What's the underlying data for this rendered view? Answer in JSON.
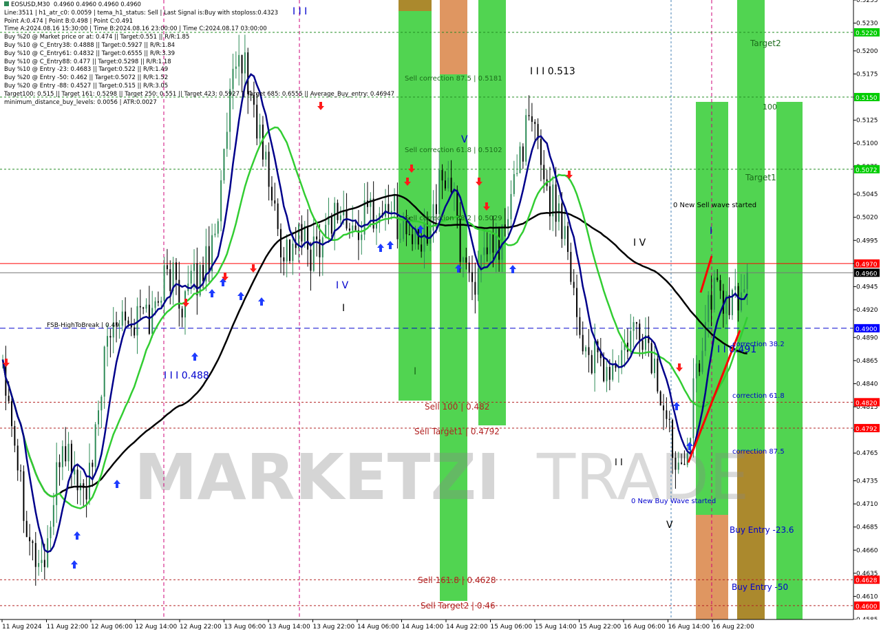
{
  "window": {
    "symbol": "EOSUSD,M30",
    "ohlc": "0.4960 0.4960 0.4960 0.4960"
  },
  "info_lines": [
    "Line:3511 | h1_atr_c0: 0.0059 | tema_h1_status: Sell | Last Signal is:Buy with stoploss:0.4323",
    "Point A:0.474 | Point B:0.498 | Point C:0.491",
    "Time A:2024.08.16 15:30:00 | Time B:2024.08.16 23:00:00 | Time C:2024.08.17 03:00:00",
    "Buy %20 @ Market price or at: 0.474 || Target:0.551 || R/R:1.85",
    "Buy %10 @ C_Entry38: 0.4888 || Target:0.5927 || R/R:1.84",
    "Buy %10 @ C_Entry61: 0.4832 || Target:0.6555 || R/R:3.39",
    "Buy %10 @ C_Entry88: 0.477 || Target:0.5298 || R/R:1.18",
    "Buy %10 @ Entry -23: 0.4683 || Target:0.522 || R/R:1.49",
    "Buy %20 @ Entry -50: 0.462 || Target:0.5072 || R/R:1.52",
    "Buy %20 @ Entry -88: 0.4527 || Target:0.515 || R/R:3.05",
    "Target100: 0.515 || Target 161: 0.5298 || Target 250: 0.551 || Target 423: 0.5927 || Target 685: 0.6555 || Average_Buy_entry: 0.46947",
    "minimum_distance_buy_levels: 0.0056 | ATR:0.0027"
  ],
  "watermark": {
    "bold": "MARKETZI",
    "light": "TRADE"
  },
  "colors": {
    "green_zone": "#32cd32",
    "orange_zone": "#d2691e",
    "candle_up": "#2e8b57",
    "candle_down": "#000000",
    "ma_fast": "#00008b",
    "ma_mid": "#32cd32",
    "ma_slow": "#000000",
    "bid_line": "#ff0000",
    "price_tag_red": "#ff0000",
    "price_tag_green": "#00cc00",
    "price_tag_blue": "#0000ff",
    "price_tag_dark": "#000000"
  },
  "chart_data": {
    "type": "candlestick",
    "symbol": "EOSUSD",
    "timeframe": "M30",
    "ylim": [
      0.4585,
      0.5255
    ],
    "y_ticks": [
      "0.5255",
      "0.5230",
      "0.5200",
      "0.5175",
      "0.5150",
      "0.5125",
      "0.5100",
      "0.5075",
      "0.5045",
      "0.5020",
      "0.4995",
      "0.4970",
      "0.4945",
      "0.4920",
      "0.4890",
      "0.4865",
      "0.4840",
      "0.4815",
      "0.4790",
      "0.4765",
      "0.4735",
      "0.4710",
      "0.4685",
      "0.4660",
      "0.4635",
      "0.4610",
      "0.4585"
    ],
    "x_labels": [
      "11 Aug 2024",
      "11 Aug 22:00",
      "12 Aug 06:00",
      "12 Aug 14:00",
      "12 Aug 22:00",
      "13 Aug 06:00",
      "13 Aug 14:00",
      "13 Aug 22:00",
      "14 Aug 06:00",
      "14 Aug 14:00",
      "14 Aug 22:00",
      "15 Aug 06:00",
      "15 Aug 14:00",
      "15 Aug 22:00",
      "16 Aug 06:00",
      "16 Aug 14:00",
      "16 Aug 22:00"
    ],
    "bars_count": 250,
    "close_path": [
      0.487,
      0.48,
      0.472,
      0.466,
      0.464,
      0.47,
      0.478,
      0.475,
      0.472,
      0.474,
      0.485,
      0.49,
      0.493,
      0.49,
      0.492,
      0.491,
      0.495,
      0.496,
      0.493,
      0.4945,
      0.496,
      0.499,
      0.505,
      0.515,
      0.52,
      0.515,
      0.51,
      0.505,
      0.499,
      0.4985,
      0.5,
      0.498,
      0.5,
      0.502,
      0.503,
      0.5,
      0.501,
      0.503,
      0.502,
      0.504,
      0.501,
      0.5,
      0.498,
      0.502,
      0.505,
      0.507,
      0.499,
      0.496,
      0.495,
      0.499,
      0.499,
      0.502,
      0.509,
      0.512,
      0.51,
      0.504,
      0.503,
      0.499,
      0.49,
      0.487,
      0.486,
      0.485,
      0.486,
      0.488,
      0.49,
      0.488,
      0.484,
      0.479,
      0.476,
      0.478,
      0.486,
      0.492,
      0.495,
      0.492,
      0.493,
      0.496
    ],
    "current_price": 0.496,
    "price_tags": [
      {
        "value": "0.5220",
        "y": 0.522,
        "color": "#00cc00"
      },
      {
        "value": "0.5150",
        "y": 0.515,
        "color": "#00cc00"
      },
      {
        "value": "0.5072",
        "y": 0.5072,
        "color": "#00cc00"
      },
      {
        "value": "0.4970",
        "y": 0.497,
        "color": "#ff0000"
      },
      {
        "value": "0.4960",
        "y": 0.496,
        "color": "#000000"
      },
      {
        "value": "0.4900",
        "y": 0.49,
        "color": "#0000ff"
      },
      {
        "value": "0.4820",
        "y": 0.482,
        "color": "#ff0000"
      },
      {
        "value": "0.4792",
        "y": 0.4792,
        "color": "#ff0000"
      },
      {
        "value": "0.4628",
        "y": 0.4628,
        "color": "#ff0000"
      },
      {
        "value": "0.4600",
        "y": 0.46,
        "color": "#ff0000"
      }
    ],
    "annotations": [
      {
        "text": "Sell correction 87.5 | 0.5181",
        "color": "#1a6b1a"
      },
      {
        "text": "Sell correction 61.8 | 0.5102",
        "color": "#1a6b1a"
      },
      {
        "text": "Sell correction 38.2 | 0.5029",
        "color": "#1a6b1a"
      },
      {
        "text": "Sell 100 | 0.482",
        "color": "#b22222"
      },
      {
        "text": "Sell Target1 | 0.4792",
        "color": "#b22222"
      },
      {
        "text": "Sell 161.8 | 0.4628",
        "color": "#b22222"
      },
      {
        "text": "Sell Target2 | 0.46",
        "color": "#b22222"
      },
      {
        "text": "FSB-HighToBreak | 0.49",
        "color": "#000000"
      },
      {
        "text": "Target2",
        "color": "#1a6b1a"
      },
      {
        "text": "100",
        "color": "#1a6b1a"
      },
      {
        "text": "Target1",
        "color": "#1a6b1a"
      },
      {
        "text": "0 New Sell wave started",
        "color": "#000000"
      },
      {
        "text": "correction 38.2",
        "color": "#0000cd"
      },
      {
        "text": "correction 61.8",
        "color": "#0000cd"
      },
      {
        "text": "correction 87.5",
        "color": "#0000cd"
      },
      {
        "text": "0 New Buy Wave started",
        "color": "#0000cd"
      },
      {
        "text": "Buy Entry -23.6",
        "color": "#0000cd"
      },
      {
        "text": "Buy Entry -50",
        "color": "#0000cd"
      },
      {
        "text": "I I I 0.513",
        "color": "#000000"
      },
      {
        "text": "I I I 0.488",
        "color": "#0000cd"
      },
      {
        "text": "I I 0.491",
        "color": "#0000cd"
      },
      {
        "text": "I I I",
        "color": "#0000cd"
      },
      {
        "text": "I V",
        "color": "#0000cd"
      },
      {
        "text": "I V",
        "color": "#000000"
      },
      {
        "text": "I I",
        "color": "#000000"
      },
      {
        "text": "V",
        "color": "#0000cd"
      },
      {
        "text": "V",
        "color": "#000000"
      },
      {
        "text": "I",
        "color": "#000000"
      },
      {
        "text": "I",
        "color": "#1a6b1a"
      },
      {
        "text": "I",
        "color": "#0000cd"
      }
    ]
  }
}
